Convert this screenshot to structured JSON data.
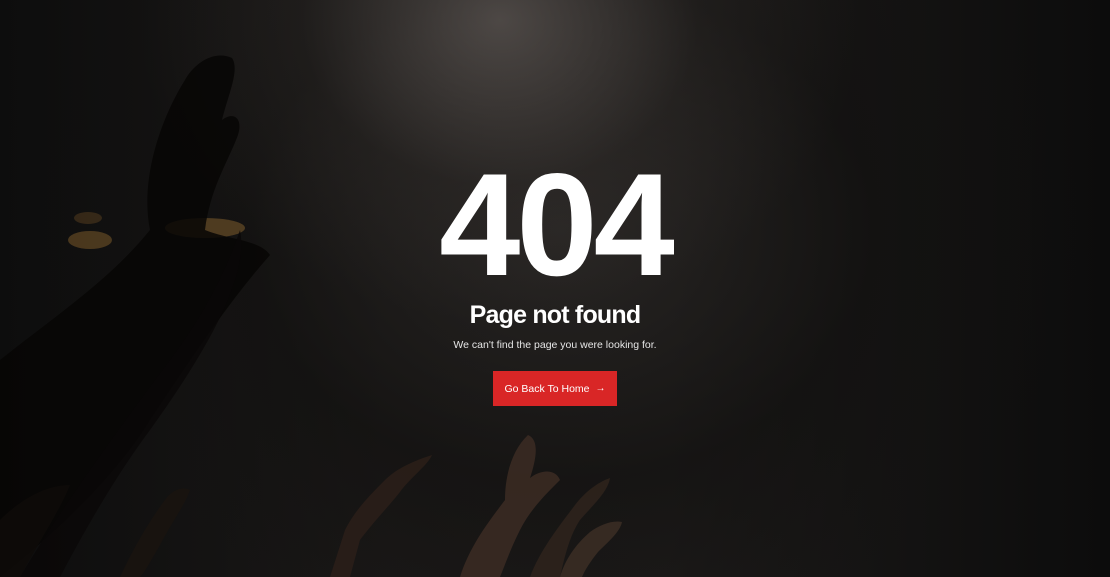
{
  "error": {
    "code": "404",
    "title": "Page not found",
    "message": "We can't find the page you were looking for.",
    "button_label": "Go Back To Home",
    "button_icon": "arrow-right-icon",
    "button_color": "#d92626"
  },
  "background": {
    "image_subject": "concert-crowd-hands-photo"
  }
}
